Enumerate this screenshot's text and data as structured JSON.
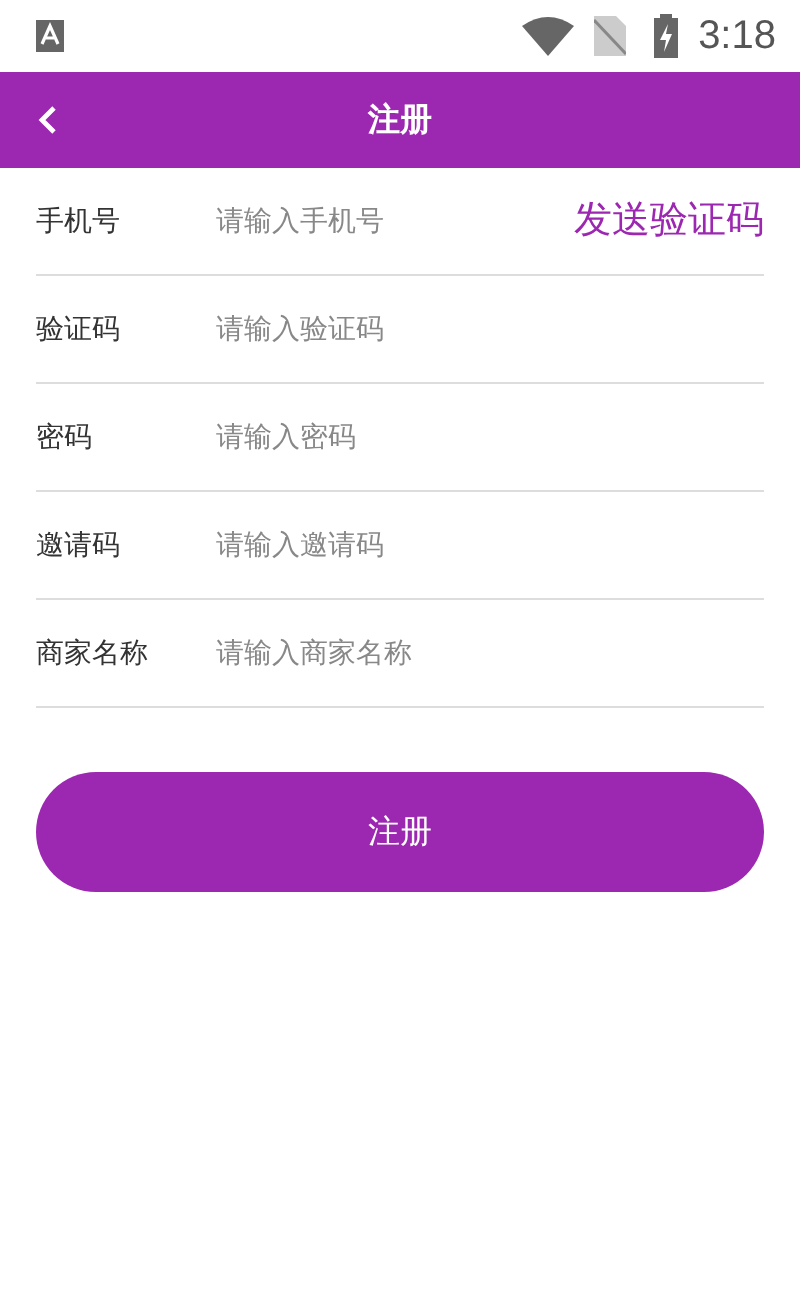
{
  "status_bar": {
    "time": "3:18"
  },
  "app_bar": {
    "title": "注册"
  },
  "fields": [
    {
      "label": "手机号",
      "placeholder": "请输入手机号",
      "action": "发送验证码"
    },
    {
      "label": "验证码",
      "placeholder": "请输入验证码"
    },
    {
      "label": "密码",
      "placeholder": "请输入密码"
    },
    {
      "label": "邀请码",
      "placeholder": "请输入邀请码"
    },
    {
      "label": "商家名称",
      "placeholder": "请输入商家名称"
    }
  ],
  "submit_button": "注册"
}
